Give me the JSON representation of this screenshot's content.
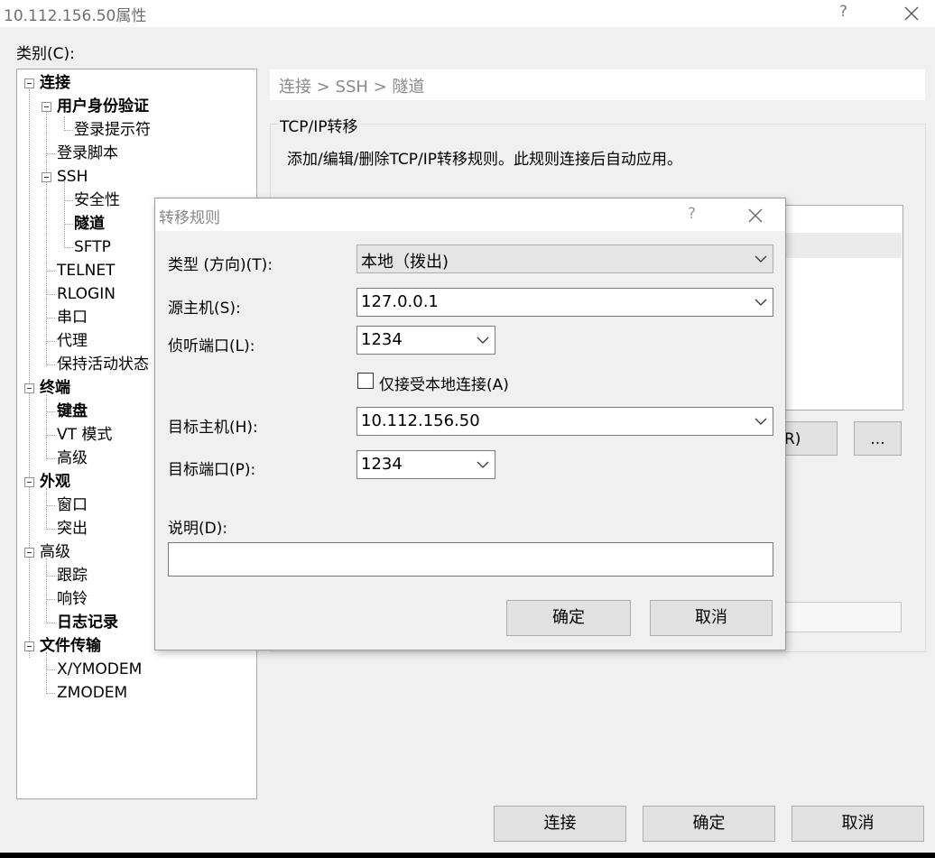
{
  "window": {
    "title": "10.112.156.50属性",
    "help": "?"
  },
  "category_label": "类别(C):",
  "tree": {
    "connection": "连接",
    "auth": "用户身份验证",
    "login_prompt": "登录提示符",
    "login_script": "登录脚本",
    "ssh": "SSH",
    "security": "安全性",
    "tunnel": "隧道",
    "sftp": "SFTP",
    "telnet": "TELNET",
    "rlogin": "RLOGIN",
    "serial": "串口",
    "proxy": "代理",
    "keepalive": "保持活动状态",
    "terminal": "终端",
    "keyboard": "键盘",
    "vt_mode": "VT 模式",
    "term_advanced": "高级",
    "appearance": "外观",
    "window": "窗口",
    "highlight": "突出",
    "advanced": "高级",
    "trace": "跟踪",
    "bell": "响铃",
    "logging": "日志记录",
    "file_transfer": "文件传输",
    "xymodem": "X/YMODEM",
    "zmodem": "ZMODEM"
  },
  "breadcrumb": "连接 > SSH > 隧道",
  "group": {
    "title": "TCP/IP转移",
    "description": "添加/编辑/删除TCP/IP转移规则。此规则连接后自动应用。",
    "partial_button": "R)",
    "ellipsis_button": "..."
  },
  "bottom_buttons": {
    "connect": "连接",
    "ok": "确定",
    "cancel": "取消"
  },
  "dialog": {
    "title": "转移规则",
    "help": "?",
    "type_label": "类型 (方向)(T):",
    "type_value": "本地（拨出)",
    "source_host_label": "源主机(S):",
    "source_host_value": "127.0.0.1",
    "listen_port_label": "侦听端口(L):",
    "listen_port_value": "1234",
    "local_only_label": "仅接受本地连接(A)",
    "local_only_checked": false,
    "target_host_label": "目标主机(H):",
    "target_host_value": "10.112.156.50",
    "target_port_label": "目标端口(P):",
    "target_port_value": "1234",
    "description_label": "说明(D):",
    "description_value": "",
    "ok": "确定",
    "cancel": "取消"
  }
}
